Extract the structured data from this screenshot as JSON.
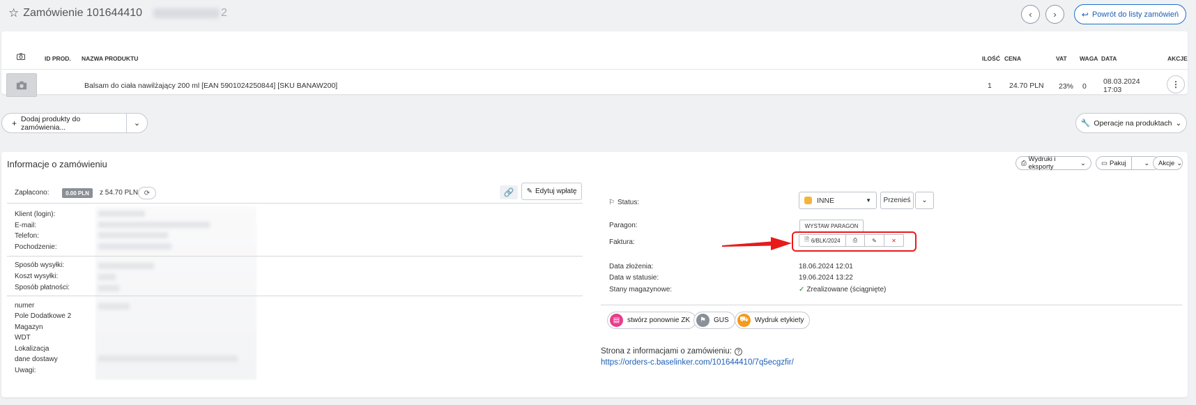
{
  "header": {
    "order_title": "Zamówienie 101644410",
    "order_title_tail": "2",
    "back_label": "Powrót do listy zamówień"
  },
  "products": {
    "columns": {
      "id": "ID PROD.",
      "name": "NAZWA PRODUKTU",
      "qty": "ILOŚĆ",
      "price": "CENA",
      "vat": "VAT",
      "weight": "WAGA",
      "date": "DATA",
      "actions": "AKCJE"
    },
    "rows": [
      {
        "name": "Balsam do ciała nawilżający 200 ml [EAN 5901024250844] [SKU BANAW200]",
        "qty": "1",
        "price": "24.70 PLN",
        "vat": "23%",
        "weight": "0",
        "date_line1": "08.03.2024",
        "date_line2": "17:03"
      }
    ]
  },
  "toolbar": {
    "add_products": "Dodaj produkty do zamówienia...",
    "product_ops": "Operacje na produktach"
  },
  "info": {
    "title": "Informacje o zamówieniu",
    "prints_label": "Wydruki i eksporty",
    "pack_label": "Pakuj",
    "actions_label": "Akcje",
    "paid_label": "Zapłacono:",
    "paid_amount": "0.00 PLN",
    "paid_total": "z 54.70 PLN",
    "edit_payment": "Edytuj wpłatę",
    "client_labels": [
      "Klient (login):",
      "E-mail:",
      "Telefon:",
      "Pochodzenie:"
    ],
    "shipping_labels": [
      "Sposób wysyłki:",
      "Koszt wysyłki:",
      "Sposób płatności:"
    ],
    "extra_labels": [
      "numer",
      "Pole Dodatkowe 2",
      "Magazyn",
      "WDT",
      "Lokalizacja",
      "dane dostawy",
      "Uwagi:"
    ],
    "status_label": "Status:",
    "status_value": "INNE",
    "move_label": "Przenieś",
    "receipt_label": "Paragon:",
    "receipt_button": "WYSTAW PARAGON",
    "invoice_label": "Faktura:",
    "invoice_number": "6/BLK/2024",
    "date_created_label": "Data złożenia:",
    "date_created": "18.06.2024 12:01",
    "date_status_label": "Data w statusie:",
    "date_status": "19.06.2024 13:22",
    "stock_label": "Stany magazynowe:",
    "stock_value": "Zrealizowane (ściągnięte)",
    "action_zk": "stwórz ponownie ZK",
    "action_gus": "GUS",
    "action_label": "Wydruk etykiety",
    "info_page_label": "Strona z informacjami o zamówieniu:",
    "info_page_url": "https://orders-c.baselinker.com/101644410/7q5ecgzfir/"
  },
  "colors": {
    "accent": "#1a6fd0",
    "status_inne": "#f4b43a",
    "highlight": "#e81a1a",
    "zk_icon": "#e83e8c",
    "gus_icon": "#8a8f98",
    "label_icon": "#f59a1b"
  }
}
